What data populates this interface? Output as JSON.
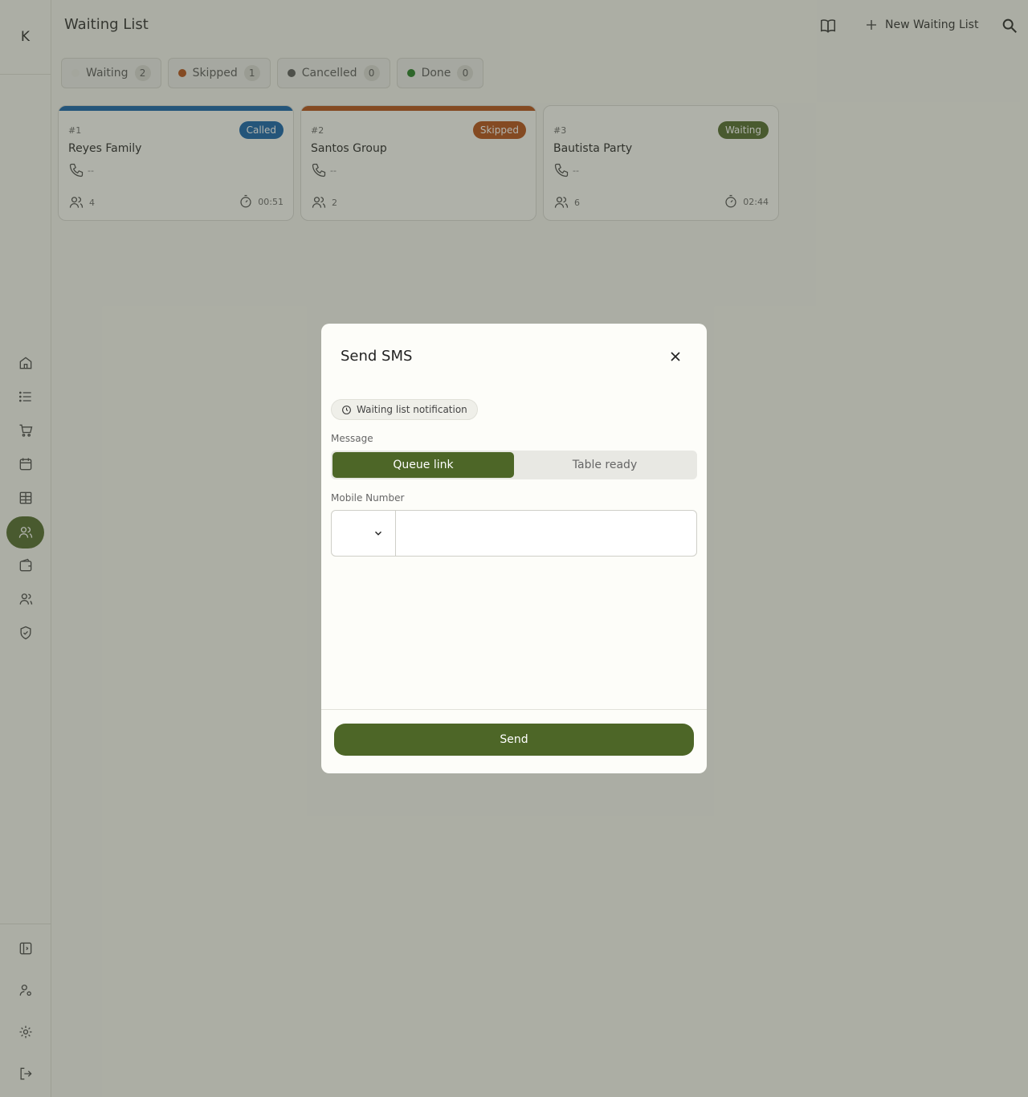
{
  "app": {
    "logo": "K"
  },
  "header": {
    "title": "Waiting List",
    "new_label": "New Waiting List"
  },
  "tabs": [
    {
      "label": "Waiting",
      "count": "2",
      "color": "#e8e8e4"
    },
    {
      "label": "Skipped",
      "count": "1",
      "color": "#b24a10"
    },
    {
      "label": "Cancelled",
      "count": "0",
      "color": "#555555"
    },
    {
      "label": "Done",
      "count": "0",
      "color": "#1e7a1e"
    }
  ],
  "cards": [
    {
      "num": "#1",
      "name": "Reyes Family",
      "phone": "--",
      "party": "4",
      "time": "00:51",
      "status": "Called",
      "color": "#0d5ea8"
    },
    {
      "num": "#2",
      "name": "Santos Group",
      "phone": "--",
      "party": "2",
      "time": "",
      "status": "Skipped",
      "color": "#b24a10"
    },
    {
      "num": "#3",
      "name": "Bautista Party",
      "phone": "--",
      "party": "6",
      "time": "02:44",
      "status": "Waiting",
      "color": "#4d6627"
    }
  ],
  "modal": {
    "title": "Send SMS",
    "chip": "Waiting list notification",
    "message_label": "Message",
    "options": [
      "Queue link",
      "Table ready"
    ],
    "mobile_label": "Mobile Number",
    "phone_value": "",
    "send_label": "Send"
  },
  "colors": {
    "primary": "#4d6627"
  }
}
